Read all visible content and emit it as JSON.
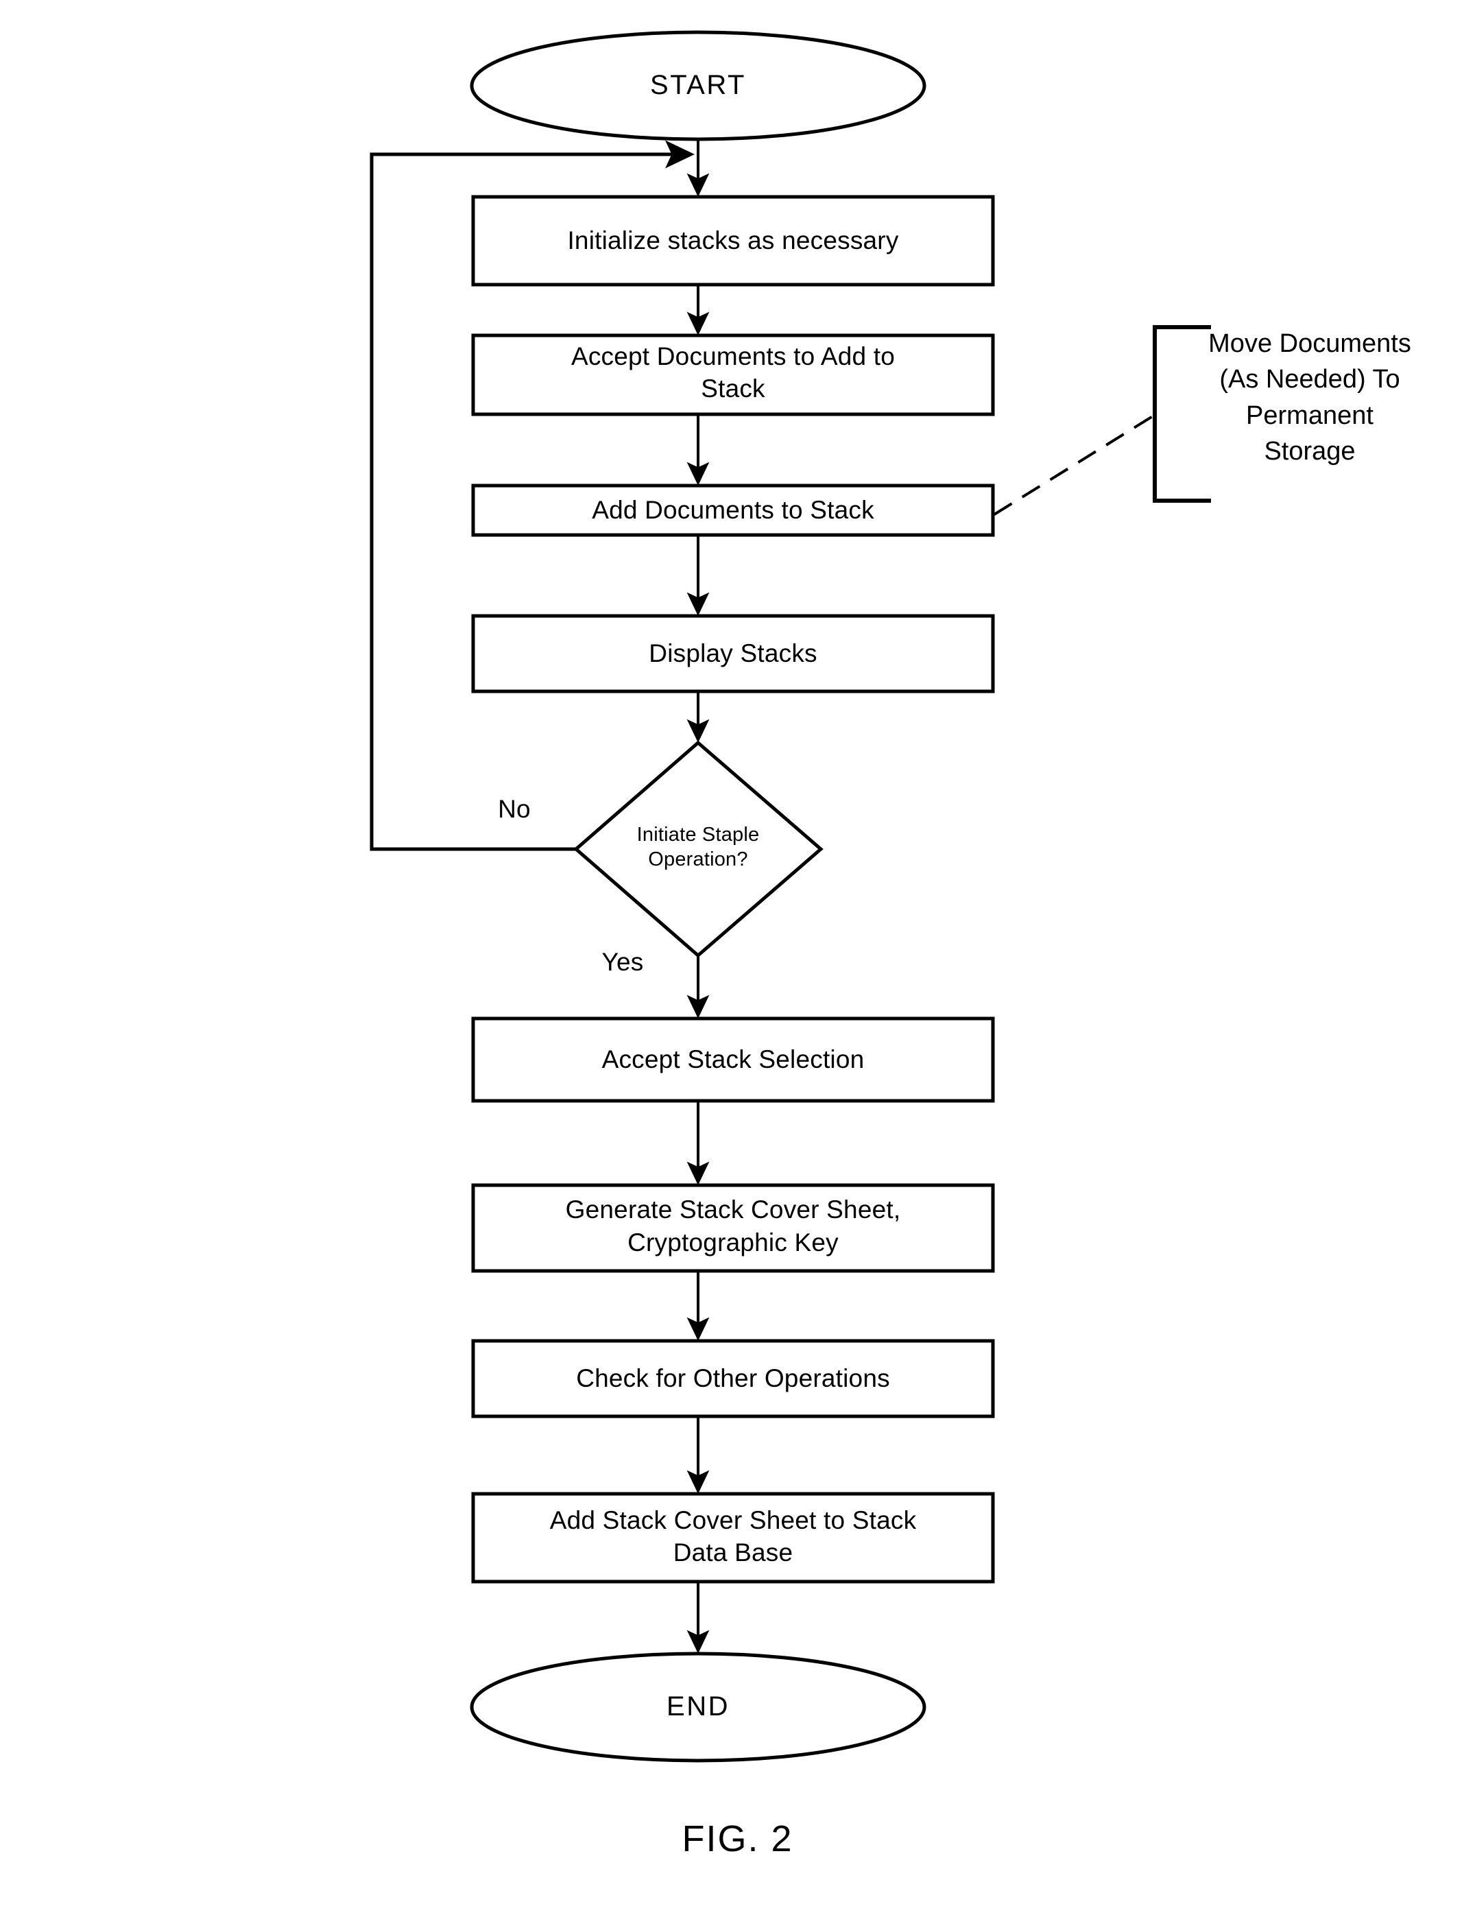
{
  "figure": {
    "caption": "FIG. 2",
    "type": "flowchart"
  },
  "nodes": {
    "start": {
      "label": "START",
      "shape": "ellipse"
    },
    "initialize": {
      "label": "Initialize stacks as necessary",
      "shape": "process"
    },
    "accept_documents": {
      "label": "Accept Documents to Add to\nStack",
      "shape": "process"
    },
    "add_documents": {
      "label": "Add Documents to Stack",
      "shape": "process"
    },
    "display_stacks": {
      "label": "Display Stacks",
      "shape": "process"
    },
    "decision": {
      "label": "Initiate Staple\nOperation?",
      "shape": "diamond"
    },
    "accept_stack_selection": {
      "label": "Accept Stack Selection",
      "shape": "process"
    },
    "generate_cover_sheet": {
      "label": "Generate Stack Cover Sheet,\nCryptographic Key",
      "shape": "process"
    },
    "check_other_operations": {
      "label": "Check for Other Operations",
      "shape": "process"
    },
    "add_cover_sheet_db": {
      "label": "Add Stack Cover Sheet to Stack\nData Base",
      "shape": "process"
    },
    "end": {
      "label": "END",
      "shape": "ellipse"
    }
  },
  "annotations": {
    "move_documents": {
      "label": "Move Documents\n(As Needed) To\nPermanent\nStorage",
      "shape": "bracket-callout",
      "connector": "dashed-line"
    }
  },
  "edge_labels": {
    "no": "No",
    "yes": "Yes"
  },
  "colors": {
    "stroke": "#000000",
    "background": "#ffffff",
    "text": "#000000"
  }
}
